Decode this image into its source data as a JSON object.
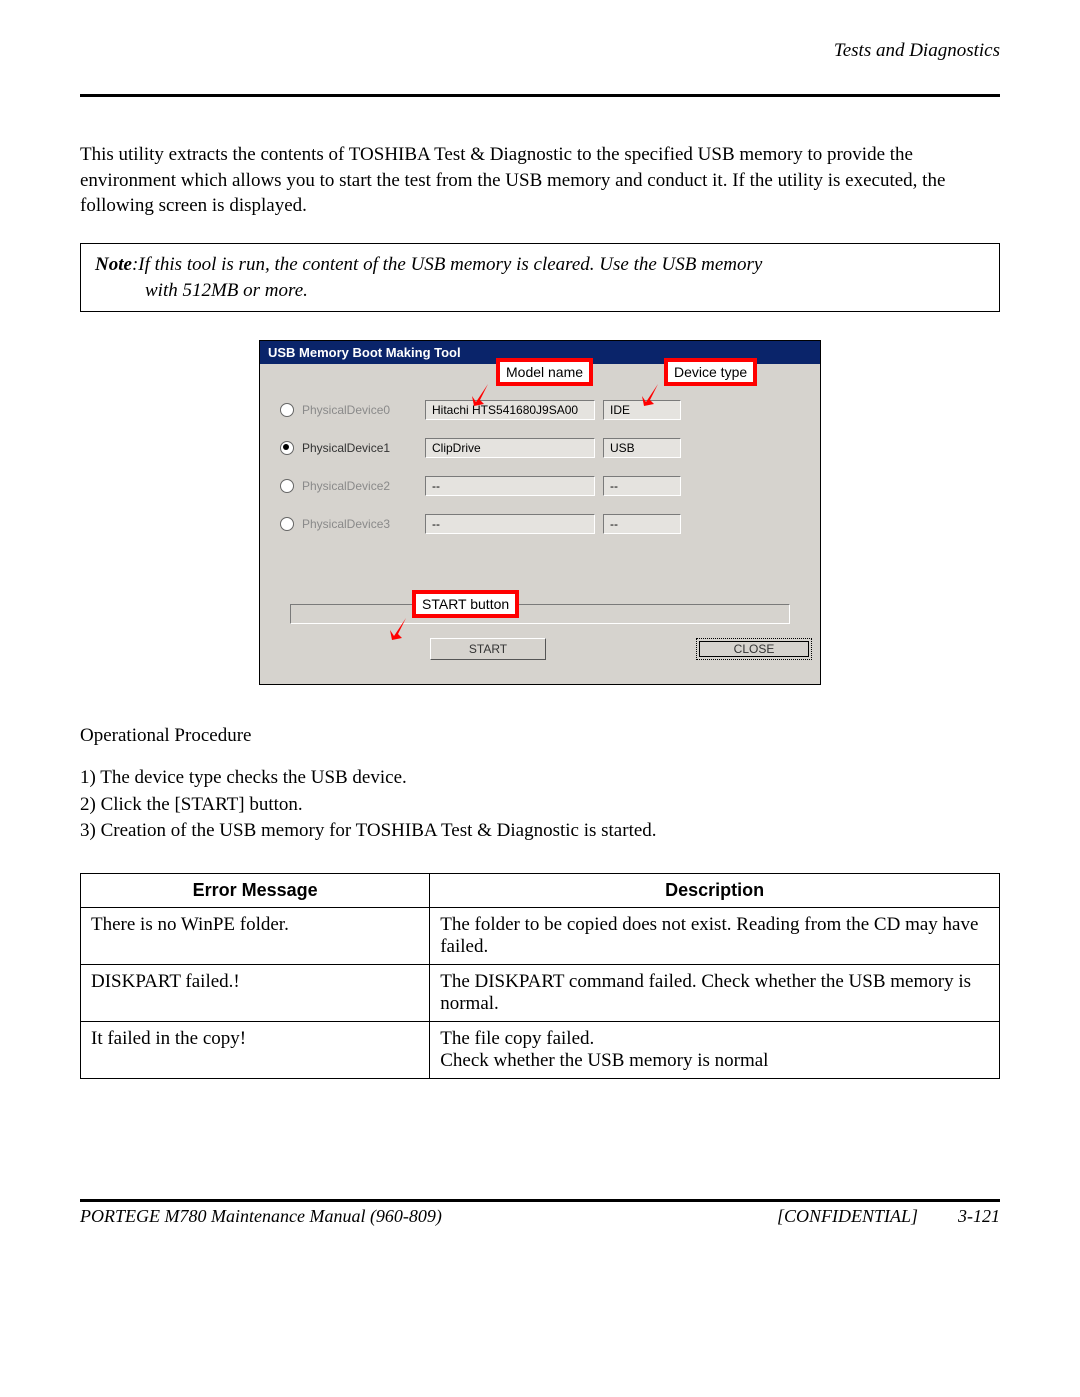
{
  "header": {
    "section_title": "Tests and Diagnostics"
  },
  "intro_text": "This utility extracts the contents of TOSHIBA Test & Diagnostic to the specified USB memory to provide the environment which allows you to start the test from the USB memory and conduct it. If the utility is executed, the following screen is displayed.",
  "note": {
    "label": "Note",
    "line1": ":If this tool is run, the content of the USB memory is cleared. Use the USB memory",
    "line2": "with 512MB or more."
  },
  "tool": {
    "window_title": "USB Memory Boot Making Tool",
    "callouts": {
      "model_name": "Model name",
      "device_type": "Device type",
      "start_button": "START button"
    },
    "devices": [
      {
        "label": "PhysicalDevice0",
        "model": "Hitachi HTS541680J9SA00",
        "type": "IDE",
        "selected": false,
        "enabled": false
      },
      {
        "label": "PhysicalDevice1",
        "model": "ClipDrive",
        "type": "USB",
        "selected": true,
        "enabled": true
      },
      {
        "label": "PhysicalDevice2",
        "model": "--",
        "type": "--",
        "selected": false,
        "enabled": false
      },
      {
        "label": "PhysicalDevice3",
        "model": "--",
        "type": "--",
        "selected": false,
        "enabled": false
      }
    ],
    "buttons": {
      "start": "START",
      "close": "CLOSE"
    }
  },
  "procedure": {
    "heading": "Operational Procedure",
    "steps": [
      "1) The device type checks the USB device.",
      "2) Click the [START] button.",
      "3) Creation of the USB memory for TOSHIBA Test & Diagnostic is started."
    ]
  },
  "error_table": {
    "headers": {
      "msg": "Error Message",
      "desc": "Description"
    },
    "rows": [
      {
        "msg": "There is no WinPE folder.",
        "desc": "The folder to be copied does not exist. Reading from the CD may have failed."
      },
      {
        "msg": "DISKPART failed.!",
        "desc": "The DISKPART command failed. Check whether the USB memory is normal."
      },
      {
        "msg": "It failed in the copy!",
        "desc": "The file copy failed.\nCheck whether the USB memory is normal"
      }
    ]
  },
  "footer": {
    "left": "PORTEGE M780 Maintenance Manual (960-809)",
    "center": "[CONFIDENTIAL]",
    "right": "3-121"
  }
}
